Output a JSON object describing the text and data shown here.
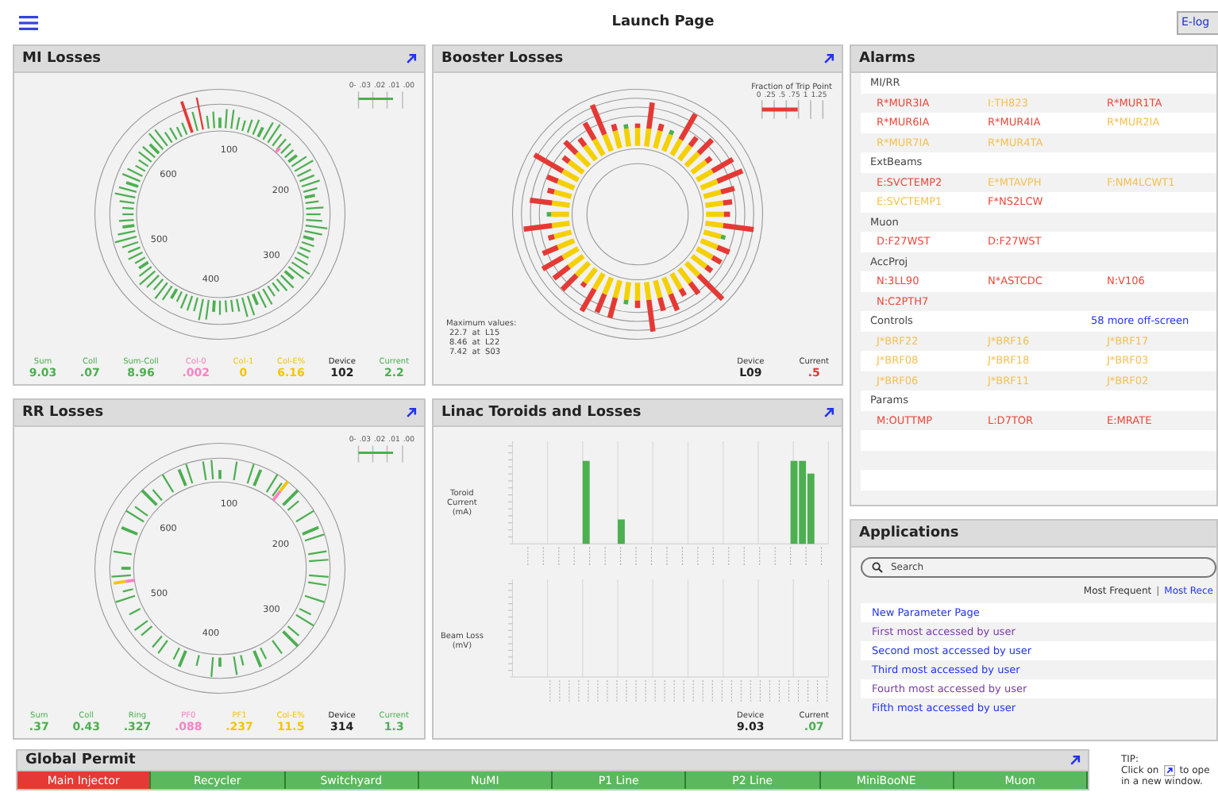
{
  "header": {
    "title": "Launch Page",
    "elog_button": "E-log"
  },
  "mi_losses": {
    "title": "MI Losses",
    "legend_ticks": [
      "0-",
      ".03",
      ".02",
      ".01",
      ".00"
    ],
    "ring_labels": [
      "100",
      "200",
      "300",
      "400",
      "500",
      "600"
    ],
    "stats": [
      {
        "label": "Sum",
        "value": "9.03",
        "color": "#4caf50"
      },
      {
        "label": "Coll",
        "value": ".07",
        "color": "#4caf50"
      },
      {
        "label": "Sum-Coll",
        "value": "8.96",
        "color": "#4caf50"
      },
      {
        "label": "Col-0",
        "value": ".002",
        "color": "#ff80c0"
      },
      {
        "label": "Col-1",
        "value": "0",
        "color": "#f5c400"
      },
      {
        "label": "Col-E%",
        "value": "6.16",
        "color": "#f5c400"
      },
      {
        "label": "Device",
        "value": "102",
        "color": "#222222"
      },
      {
        "label": "Current",
        "value": "2.2",
        "color": "#4caf50"
      }
    ]
  },
  "booster_losses": {
    "title": "Booster Losses",
    "legend_title": "Fraction of Trip Point",
    "legend_ticks": [
      "0",
      ".25",
      ".5",
      ".75",
      "1",
      "1.25"
    ],
    "max_title": "Maximum values:",
    "max_values": [
      "22.7  at  L15",
      "8.46  at  L22",
      "7.42  at  S03"
    ],
    "stats": [
      {
        "label": "Device",
        "value": "L09",
        "color": "#222222"
      },
      {
        "label": "Current",
        "value": ".5",
        "color": "#e53935"
      }
    ]
  },
  "rr_losses": {
    "title": "RR Losses",
    "legend_ticks": [
      "0-",
      ".03",
      ".02",
      ".01",
      ".00"
    ],
    "ring_labels": [
      "100",
      "200",
      "300",
      "400",
      "500",
      "600"
    ],
    "stats": [
      {
        "label": "Sum",
        "value": ".37",
        "color": "#4caf50"
      },
      {
        "label": "Coll",
        "value": "0.43",
        "color": "#4caf50"
      },
      {
        "label": "Ring",
        "value": ".327",
        "color": "#4caf50"
      },
      {
        "label": "PF0",
        "value": ".088",
        "color": "#ff80c0"
      },
      {
        "label": "PF1",
        "value": ".237",
        "color": "#f5c400"
      },
      {
        "label": "Col-E%",
        "value": "11.5",
        "color": "#f5c400"
      },
      {
        "label": "Device",
        "value": "314",
        "color": "#222222"
      },
      {
        "label": "Current",
        "value": "1.3",
        "color": "#4caf50"
      }
    ]
  },
  "linac": {
    "title": "Linac Toroids and Losses",
    "top_axis_label": "Toroid Current (mA)",
    "bottom_axis_label": "Beam Loss (mV)",
    "stats": [
      {
        "label": "Device",
        "value": "9.03",
        "color": "#222222"
      },
      {
        "label": "Current",
        "value": ".07",
        "color": "#4caf50"
      }
    ]
  },
  "alarms": {
    "title": "Alarms",
    "groups": [
      {
        "name": "MI/RR",
        "rows": [
          [
            {
              "text": "R*MUR3IA",
              "color": "#e8473a"
            },
            {
              "text": "I:TH823",
              "color": "#f5c050"
            },
            {
              "text": "R*MUR1TA",
              "color": "#e8473a"
            }
          ],
          [
            {
              "text": "R*MUR6IA",
              "color": "#e8473a"
            },
            {
              "text": "R*MUR4IA",
              "color": "#e8473a"
            },
            {
              "text": "R*MUR2IA",
              "color": "#f5c050"
            }
          ],
          [
            {
              "text": "R*MUR7IA",
              "color": "#f5c050"
            },
            {
              "text": "R*MUR4TA",
              "color": "#f5c050"
            }
          ]
        ]
      },
      {
        "name": "ExtBeams",
        "rows": [
          [
            {
              "text": "E:SVCTEMP2",
              "color": "#e8473a"
            },
            {
              "text": "E*MTAVPH",
              "color": "#f5c050"
            },
            {
              "text": "F:NM4LCWT1",
              "color": "#f5c050"
            }
          ],
          [
            {
              "text": "E:SVCTEMP1",
              "color": "#f5c050"
            },
            {
              "text": "F*NS2LCW",
              "color": "#e8473a"
            }
          ]
        ]
      },
      {
        "name": "Muon",
        "rows": [
          [
            {
              "text": "D:F27WST",
              "color": "#e8473a"
            },
            {
              "text": "D:F27WST",
              "color": "#e8473a"
            }
          ]
        ]
      },
      {
        "name": "AccProj",
        "rows": [
          [
            {
              "text": "N:3LL90",
              "color": "#e8473a"
            },
            {
              "text": "N*ASTCDC",
              "color": "#e8473a"
            },
            {
              "text": "N:V106",
              "color": "#e8473a"
            }
          ],
          [
            {
              "text": "N:C2PTH7",
              "color": "#e8473a"
            }
          ]
        ]
      },
      {
        "name": "Controls",
        "more": "58 more off-screen",
        "rows": [
          [
            {
              "text": "J*BRF22",
              "color": "#f5c050"
            },
            {
              "text": "J*BRF16",
              "color": "#f5c050"
            },
            {
              "text": "J*BRF17",
              "color": "#f5c050"
            }
          ],
          [
            {
              "text": "J*BRF08",
              "color": "#f5c050"
            },
            {
              "text": "J*BRF18",
              "color": "#f5c050"
            },
            {
              "text": "J*BRF03",
              "color": "#f5c050"
            }
          ],
          [
            {
              "text": "J*BRF06",
              "color": "#f5c050"
            },
            {
              "text": "J*BRF11",
              "color": "#f5c050"
            },
            {
              "text": "J*BRF02",
              "color": "#f5c050"
            }
          ]
        ]
      },
      {
        "name": "Params",
        "rows": [
          [
            {
              "text": "M:OUTTMP",
              "color": "#e8473a"
            },
            {
              "text": "L:D7TOR",
              "color": "#e8473a"
            },
            {
              "text": "E:MRATE",
              "color": "#e8473a"
            }
          ]
        ]
      }
    ]
  },
  "applications": {
    "title": "Applications",
    "search": {
      "placeholder": "Search"
    },
    "sort_separator": "|",
    "sort_links": [
      {
        "label": "Most Frequent",
        "selected": true
      },
      {
        "label": "Most Rece",
        "selected": false
      }
    ],
    "items": [
      {
        "label": "New Parameter Page",
        "visited": false
      },
      {
        "label": "First most accessed by user",
        "visited": true
      },
      {
        "label": "Second most accessed by user",
        "visited": false
      },
      {
        "label": "Third most accessed by user",
        "visited": false
      },
      {
        "label": "Fourth most accessed by user",
        "visited": true
      },
      {
        "label": "Fifth most accessed by user",
        "visited": false
      }
    ]
  },
  "global_permit": {
    "title": "Global Permit",
    "cells": [
      {
        "label": "Main Injector",
        "permit": false
      },
      {
        "label": "Recycler",
        "permit": true
      },
      {
        "label": "Switchyard",
        "permit": true
      },
      {
        "label": "NuMI",
        "permit": true
      },
      {
        "label": "P1 Line",
        "permit": true
      },
      {
        "label": "P2 Line",
        "permit": true
      },
      {
        "label": "MiniBooNE",
        "permit": true
      },
      {
        "label": "Muon",
        "permit": true
      }
    ]
  },
  "tip": {
    "label": "TIP:",
    "before_icon": "Click on",
    "after_icon": "to ope",
    "line2": "in a new window."
  }
}
